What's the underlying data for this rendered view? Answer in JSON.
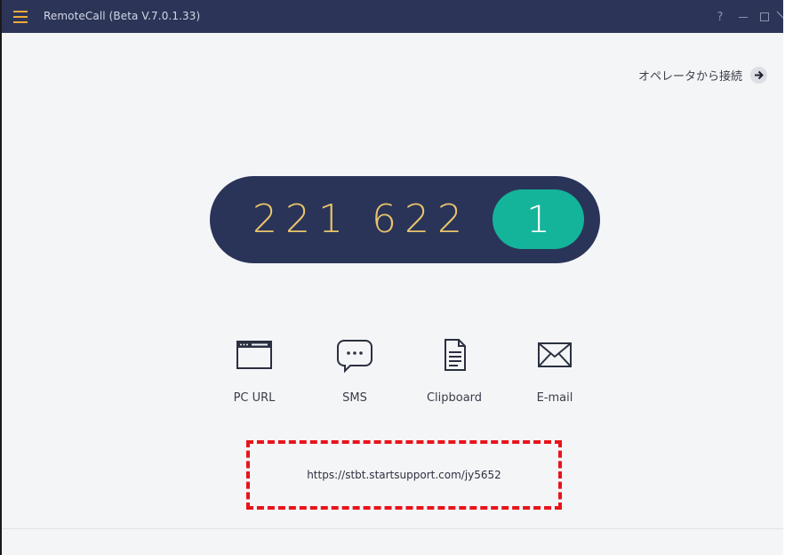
{
  "window": {
    "title": "RemoteCall (Beta V.7.0.1.33)",
    "help_label": "?"
  },
  "operator": {
    "label": "オペレータから接続"
  },
  "connection_code": {
    "digits": "221 622",
    "slot": "1"
  },
  "share": {
    "items": [
      {
        "label": "PC URL",
        "icon": "browser-window-icon"
      },
      {
        "label": "SMS",
        "icon": "chat-bubble-icon"
      },
      {
        "label": "Clipboard",
        "icon": "document-icon"
      },
      {
        "label": "E-mail",
        "icon": "envelope-icon"
      }
    ]
  },
  "url": {
    "value": "https://stbt.startsupport.com/jy5652"
  },
  "colors": {
    "titlebar": "#2c3557",
    "menu_accent": "#f2a93b",
    "pill": "#2a3459",
    "digits": "#e9c46a",
    "slot": "#14b49a",
    "highlight_border": "#e8141b"
  }
}
